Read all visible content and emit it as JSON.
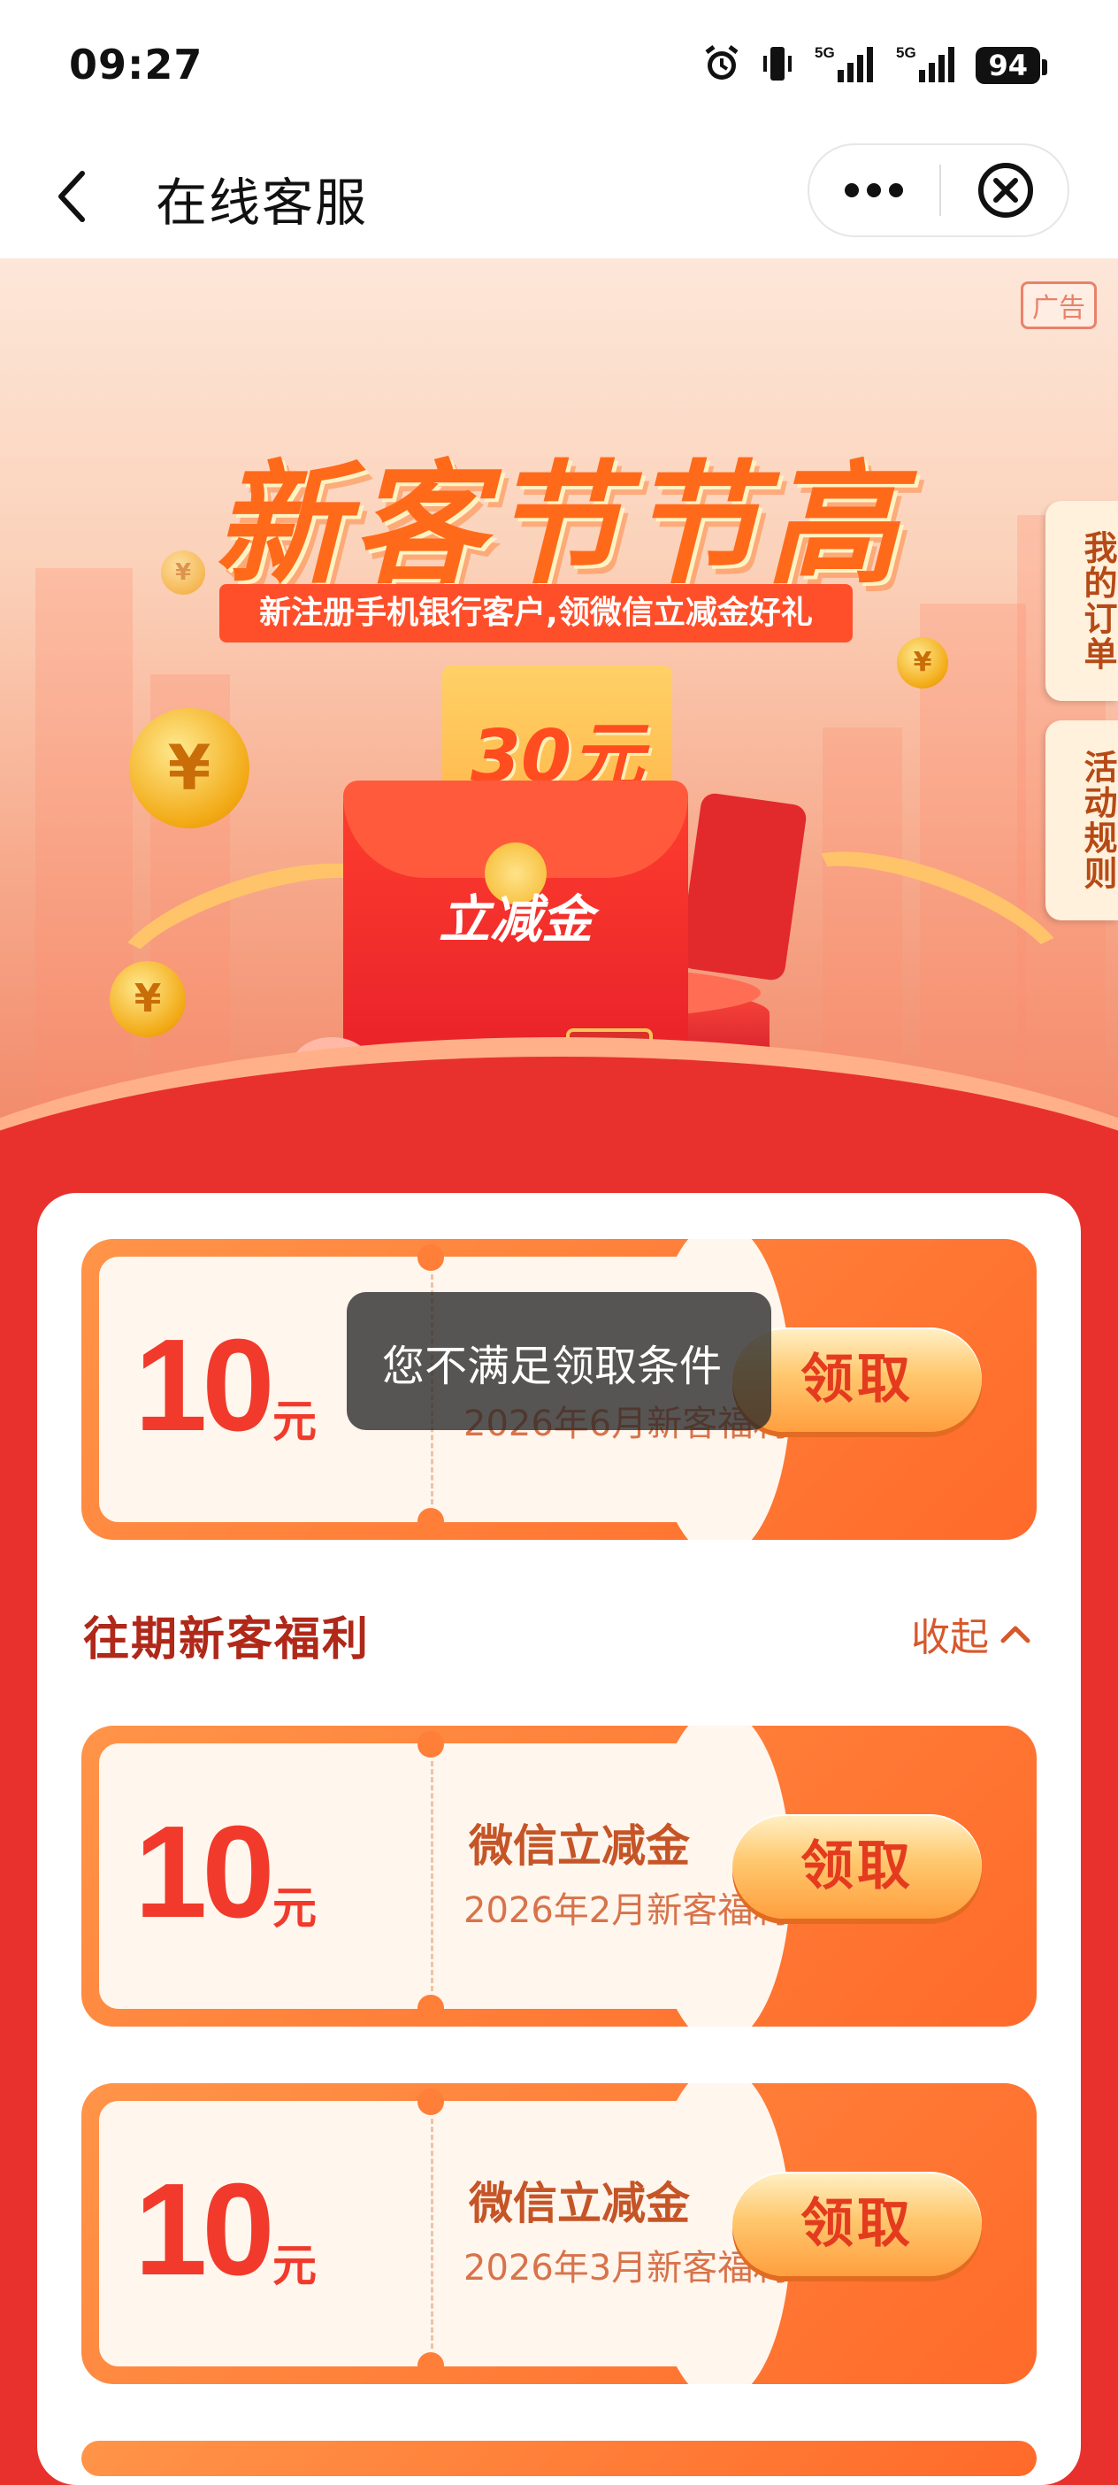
{
  "status_bar": {
    "time": "09:27",
    "signal1_label": "5G",
    "signal2_label": "5G",
    "battery": "94",
    "icons": [
      "alarm-icon",
      "vibrate-icon",
      "signal-icon",
      "signal-icon",
      "battery-icon"
    ]
  },
  "titlebar": {
    "title": "在线客服",
    "back_icon": "chevron-left-icon",
    "more_icon": "more-dots-icon",
    "close_icon": "close-circle-icon"
  },
  "banner": {
    "ad_tag": "广告",
    "headline": "新客节节高",
    "subheadline": "新注册手机银行客户,领微信立减金好礼",
    "coupon_amount": "30元",
    "envelope_text": "立减金",
    "side_tabs": [
      "我的订单",
      "活动规则"
    ]
  },
  "current_coupon": {
    "amount": "10",
    "unit": "元",
    "subtitle": "2026年6月新客福利",
    "button": "领取"
  },
  "toast": {
    "message": "您不满足领取条件"
  },
  "past_section": {
    "title": "往期新客福利",
    "collapse_label": "收起",
    "collapse_icon": "chevron-up-icon",
    "coupons": [
      {
        "amount": "10",
        "unit": "元",
        "title": "微信立减金",
        "subtitle": "2026年2月新客福利",
        "button": "领取"
      },
      {
        "amount": "10",
        "unit": "元",
        "title": "微信立减金",
        "subtitle": "2026年3月新客福利",
        "button": "领取"
      }
    ]
  },
  "colors": {
    "page_red": "#e8312c",
    "coupon_orange": "#ff7a33",
    "amount_red": "#f13a2b",
    "button_text": "#e43b1f"
  }
}
